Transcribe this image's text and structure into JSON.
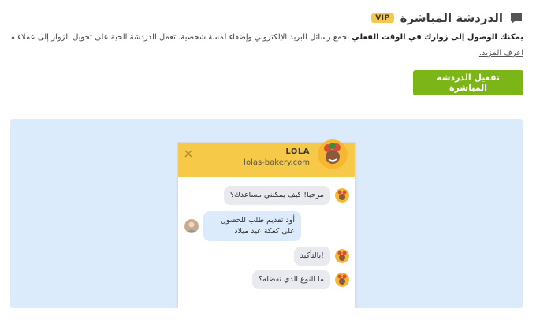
{
  "header": {
    "title": "الدردشة المباشرة",
    "badge": "VIP",
    "icon": "chat-icon"
  },
  "description": {
    "lead": "يمكنك الوصول إلى زوارك في الوقت الفعلي",
    "text": " بجمع رسائل البريد الإلكتروني وإضفاء لمسة شخصية. تعمل الدردشة الحية على تحويل الزوار إلى عملاء محتملين ذوي قيمة لعملك."
  },
  "learn_more": "اعرف المزيد.",
  "activate_button": "تفعيل الدردشة المباشرة",
  "colors": {
    "accent": "#7cb518",
    "widget_header": "#f7c948",
    "badge": "#f2c94c",
    "preview_bg": "#dcebfc"
  },
  "widget": {
    "name": "LOLA",
    "site": "lolas-bakery.com",
    "messages": [
      {
        "from": "agent",
        "text": "مرحبا! كيف يمكنني مساعدك؟"
      },
      {
        "from": "user",
        "text": "أود تقديم طلب للحصول على كعكة عيد ميلاد!"
      },
      {
        "from": "agent",
        "text": "!بالتأكيد"
      },
      {
        "from": "agent",
        "text": "ما النوع الذي تفضله؟"
      }
    ]
  }
}
